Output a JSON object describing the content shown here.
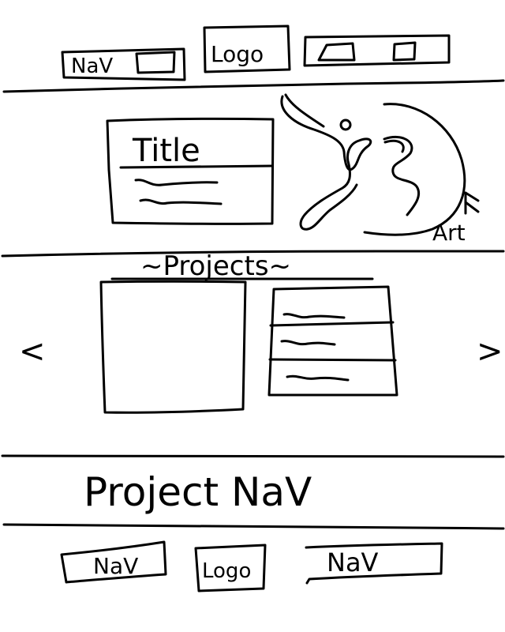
{
  "header": {
    "nav_label": "NaV",
    "logo_label": "Logo"
  },
  "hero": {
    "title": "Title",
    "art_label": "Art"
  },
  "projects": {
    "heading": "~Projects~",
    "prev_arrow": "<",
    "next_arrow": ">"
  },
  "project_nav": {
    "label": "Project NaV"
  },
  "footer": {
    "nav_left_label": "NaV",
    "logo_label": "Logo",
    "nav_right_label": "NaV"
  }
}
